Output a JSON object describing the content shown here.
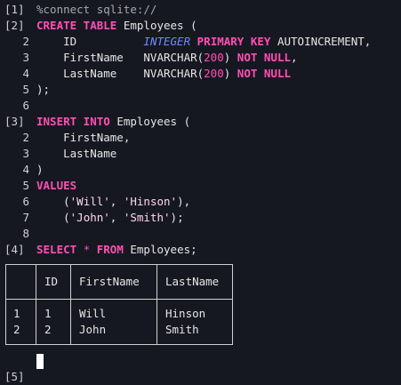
{
  "cells": [
    {
      "prompt": "[1]",
      "lines": [
        [
          {
            "t": "comment",
            "v": "%connect sqlite://"
          }
        ]
      ]
    },
    {
      "prompt": "[2]",
      "lines": [
        [
          {
            "t": "kw",
            "v": "CREATE TABLE"
          },
          {
            "t": "ident",
            "v": " Employees ("
          }
        ],
        [
          {
            "t": "ident",
            "v": "    ID          "
          },
          {
            "t": "type",
            "v": "INTEGER"
          },
          {
            "t": "ident",
            "v": " "
          },
          {
            "t": "kw",
            "v": "PRIMARY KEY"
          },
          {
            "t": "ident",
            "v": " AUTOINCREMENT,"
          }
        ],
        [
          {
            "t": "ident",
            "v": "    FirstName   NVARCHAR("
          },
          {
            "t": "num",
            "v": "200"
          },
          {
            "t": "ident",
            "v": ") "
          },
          {
            "t": "kw",
            "v": "NOT NULL"
          },
          {
            "t": "ident",
            "v": ","
          }
        ],
        [
          {
            "t": "ident",
            "v": "    LastName    NVARCHAR("
          },
          {
            "t": "num",
            "v": "200"
          },
          {
            "t": "ident",
            "v": ") "
          },
          {
            "t": "kw",
            "v": "NOT NULL"
          }
        ],
        [
          {
            "t": "ident",
            "v": ");"
          }
        ],
        []
      ]
    },
    {
      "prompt": "[3]",
      "lines": [
        [
          {
            "t": "kw",
            "v": "INSERT INTO"
          },
          {
            "t": "ident",
            "v": " Employees ("
          }
        ],
        [
          {
            "t": "ident",
            "v": "    FirstName,"
          }
        ],
        [
          {
            "t": "ident",
            "v": "    LastName"
          }
        ],
        [
          {
            "t": "ident",
            "v": ")"
          }
        ],
        [
          {
            "t": "kw",
            "v": "VALUES"
          }
        ],
        [
          {
            "t": "ident",
            "v": "    ("
          },
          {
            "t": "str",
            "v": "'Will'"
          },
          {
            "t": "ident",
            "v": ", "
          },
          {
            "t": "str",
            "v": "'Hinson'"
          },
          {
            "t": "ident",
            "v": "),"
          }
        ],
        [
          {
            "t": "ident",
            "v": "    ("
          },
          {
            "t": "str",
            "v": "'John'"
          },
          {
            "t": "ident",
            "v": ", "
          },
          {
            "t": "str",
            "v": "'Smith'"
          },
          {
            "t": "ident",
            "v": ");"
          }
        ],
        []
      ]
    },
    {
      "prompt": "[4]",
      "lines": [
        [
          {
            "t": "kw",
            "v": "SELECT"
          },
          {
            "t": "ident",
            "v": " "
          },
          {
            "t": "op",
            "v": "*"
          },
          {
            "t": "ident",
            "v": " "
          },
          {
            "t": "kw",
            "v": "FROM"
          },
          {
            "t": "ident",
            "v": " Employees;"
          }
        ]
      ]
    }
  ],
  "result": {
    "columns": [
      "ID",
      "FirstName",
      "LastName"
    ],
    "rows": [
      {
        "index": "1",
        "values": [
          "1",
          "Will",
          "Hinson"
        ]
      },
      {
        "index": "2",
        "values": [
          "2",
          "John",
          "Smith"
        ]
      }
    ]
  },
  "next_prompt": "[5]"
}
